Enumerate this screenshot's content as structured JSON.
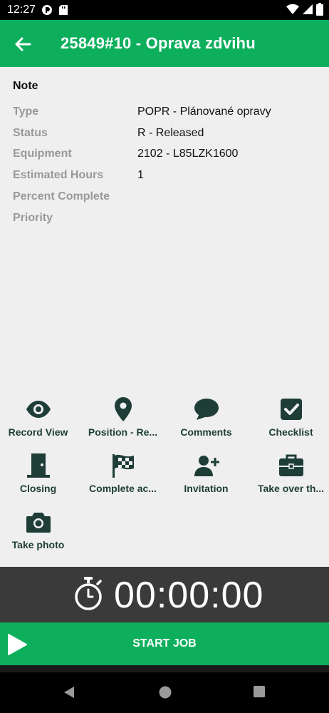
{
  "status_bar": {
    "time": "12:27"
  },
  "app_bar": {
    "title": "25849#10 - Oprava zdvihu"
  },
  "details": {
    "note_label": "Note",
    "rows": [
      {
        "label": "Type",
        "value": "POPR - Plánované opravy"
      },
      {
        "label": "Status",
        "value": "R - Released"
      },
      {
        "label": "Equipment",
        "value": "2102 - L85LZK1600"
      },
      {
        "label": "Estimated Hours",
        "value": "1"
      },
      {
        "label": "Percent Complete",
        "value": ""
      },
      {
        "label": "Priority",
        "value": ""
      }
    ]
  },
  "actions": [
    {
      "label": "Record View",
      "icon": "eye-icon"
    },
    {
      "label": "Position - Re...",
      "icon": "map-pin-icon"
    },
    {
      "label": "Comments",
      "icon": "speech-bubble-icon"
    },
    {
      "label": "Checklist",
      "icon": "checkbox-icon"
    },
    {
      "label": "Closing",
      "icon": "door-icon"
    },
    {
      "label": "Complete ac...",
      "icon": "checkered-flag-icon"
    },
    {
      "label": "Invitation",
      "icon": "add-user-icon"
    },
    {
      "label": "Take over th...",
      "icon": "briefcase-icon"
    },
    {
      "label": "Take photo",
      "icon": "camera-icon"
    }
  ],
  "timer": {
    "value": "00:00:00",
    "icon": "stopwatch-icon"
  },
  "start_button": {
    "label": "START JOB",
    "icon": "play-icon"
  },
  "colors": {
    "primary": "#0daf5d",
    "icon": "#1e3d36",
    "timer_bg": "#3a3a3a",
    "background": "#efeff0"
  }
}
